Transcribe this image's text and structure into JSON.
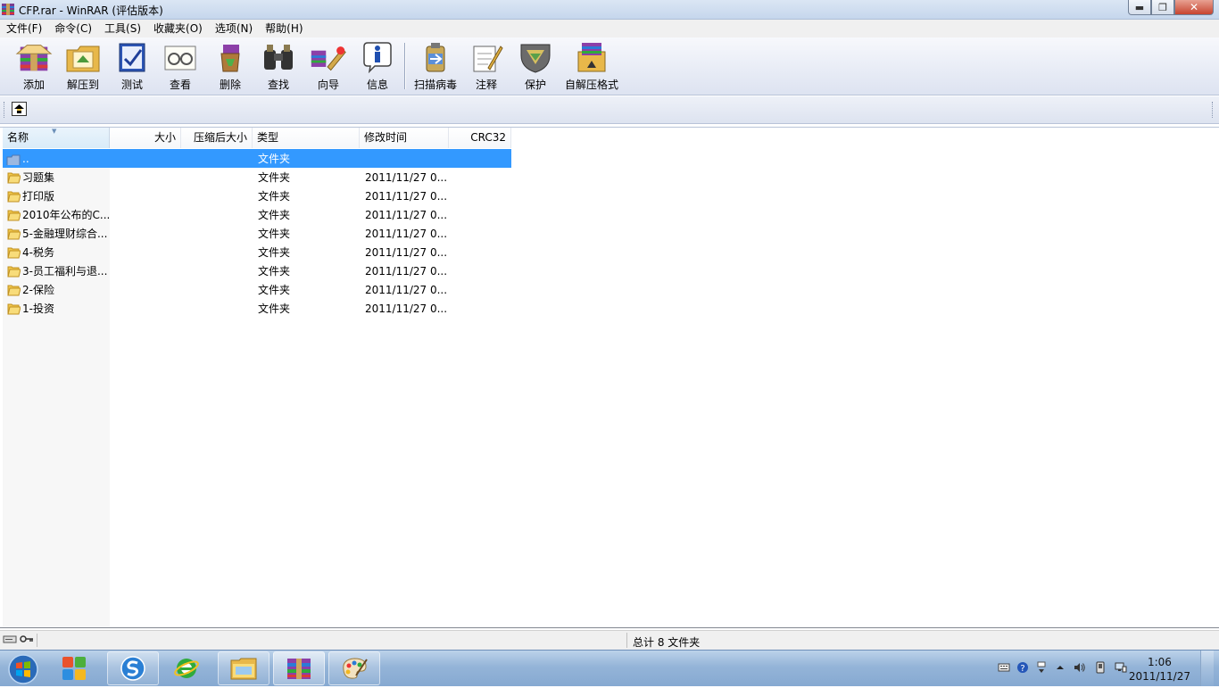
{
  "window": {
    "title": "CFP.rar - WinRAR (评估版本)",
    "minimize": "▬",
    "maximize": "❐",
    "close": "✕"
  },
  "menu": [
    "文件(F)",
    "命令(C)",
    "工具(S)",
    "收藏夹(O)",
    "选项(N)",
    "帮助(H)"
  ],
  "toolbar": {
    "add": "添加",
    "extract_to": "解压到",
    "test": "测试",
    "view": "查看",
    "delete": "删除",
    "find": "查找",
    "wizard": "向导",
    "info": "信息",
    "virus_scan": "扫描病毒",
    "comment": "注释",
    "protect": "保护",
    "sfx": "自解压格式"
  },
  "columns": {
    "name": "名称",
    "size": "大小",
    "packed": "压缩后大小",
    "type": "类型",
    "modified": "修改时间",
    "crc": "CRC32"
  },
  "rows": [
    {
      "name": "..",
      "type": "文件夹",
      "modified": ""
    },
    {
      "name": "习题集",
      "type": "文件夹",
      "modified": "2011/11/27 0..."
    },
    {
      "name": "打印版",
      "type": "文件夹",
      "modified": "2011/11/27 0..."
    },
    {
      "name": "2010年公布的C...",
      "type": "文件夹",
      "modified": "2011/11/27 0..."
    },
    {
      "name": "5-金融理财综合...",
      "type": "文件夹",
      "modified": "2011/11/27 0..."
    },
    {
      "name": "4-税务",
      "type": "文件夹",
      "modified": "2011/11/27 0..."
    },
    {
      "name": "3-员工福利与退...",
      "type": "文件夹",
      "modified": "2011/11/27 0..."
    },
    {
      "name": "2-保险",
      "type": "文件夹",
      "modified": "2011/11/27 0..."
    },
    {
      "name": "1-投资",
      "type": "文件夹",
      "modified": "2011/11/27 0..."
    }
  ],
  "status": {
    "summary": "总计 8 文件夹"
  },
  "taskbar": {
    "time": "1:06",
    "date": "2011/11/27"
  },
  "colors": {
    "selection": "#3399ff",
    "folder": "#f2c94c"
  }
}
